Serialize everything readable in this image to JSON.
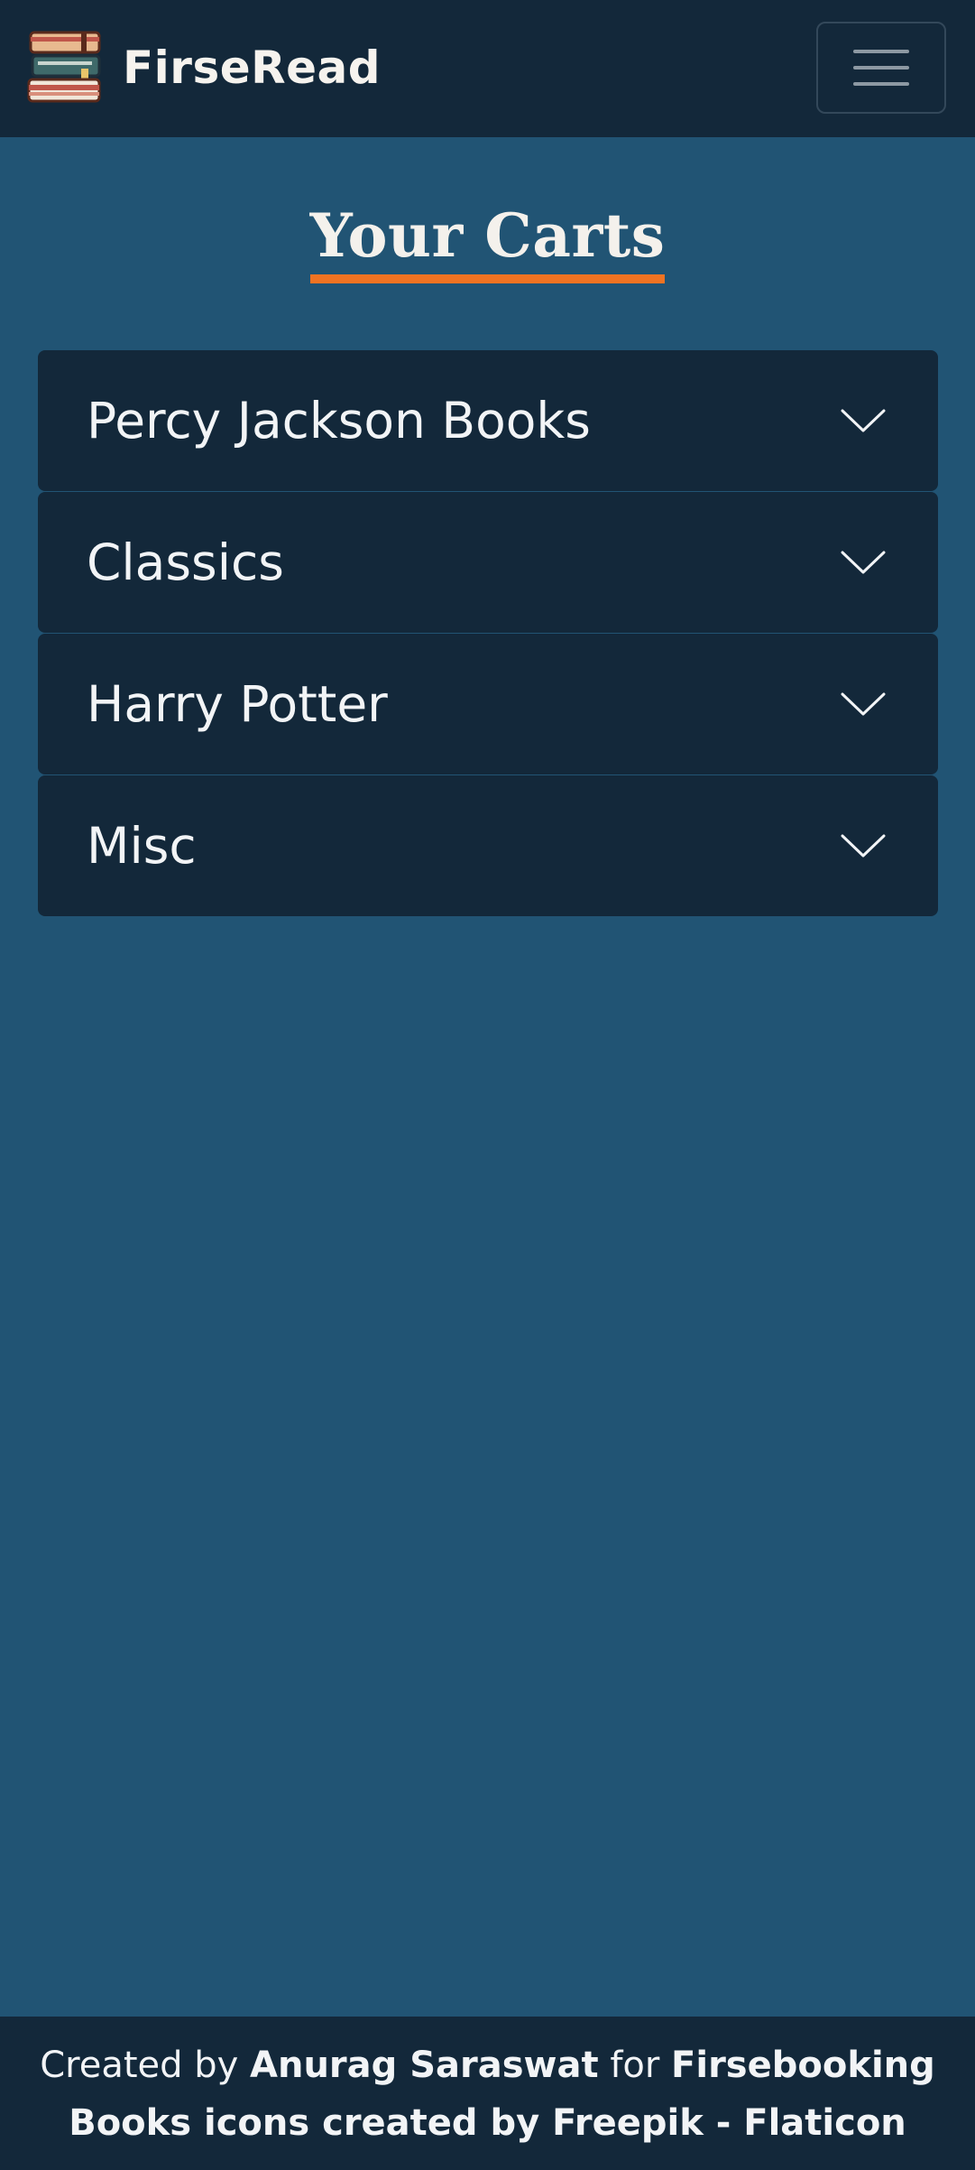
{
  "navbar": {
    "brand_name": "FirseRead",
    "logo_icon": "books-stack-icon",
    "menu_icon": "hamburger-menu-icon"
  },
  "page": {
    "title": "Your Carts",
    "accent_color": "#f07322",
    "background_color": "#215474",
    "panel_color": "#13283a"
  },
  "carts": [
    {
      "label": "Percy Jackson Books",
      "icon": "chevron-down-icon"
    },
    {
      "label": "Classics",
      "icon": "chevron-down-icon"
    },
    {
      "label": "Harry Potter",
      "icon": "chevron-down-icon"
    },
    {
      "label": "Misc",
      "icon": "chevron-down-icon"
    }
  ],
  "footer": {
    "created_by_prefix": "Created by",
    "author": "Anurag Saraswat",
    "for_text": "for",
    "organization": "Firsebooking",
    "attribution": "Books icons created by Freepik - Flaticon"
  }
}
